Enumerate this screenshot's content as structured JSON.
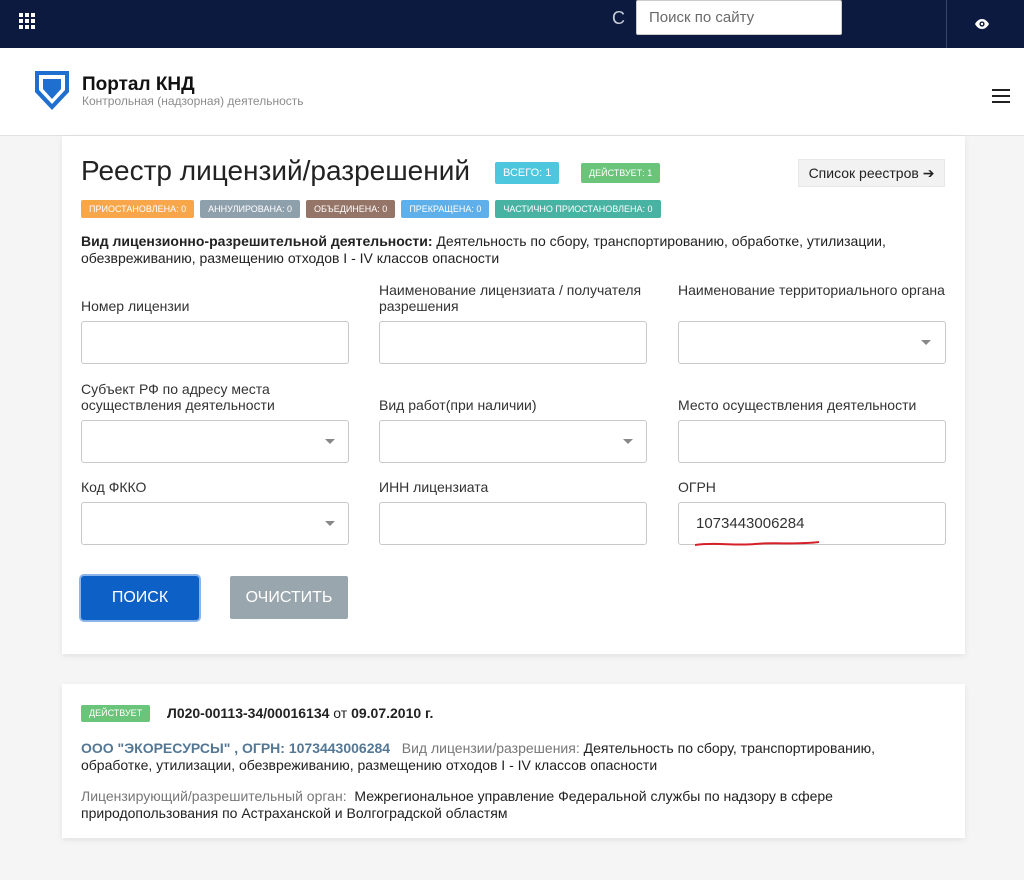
{
  "topbar": {
    "search_placeholder": "Поиск по сайту",
    "search_glyph": "С",
    "apps_icon": "apps-grid-icon",
    "eye_icon": "eye-icon"
  },
  "header": {
    "title": "Портал КНД",
    "subtitle": "Контрольная (надзорная) деятельность"
  },
  "page": {
    "title": "Реестр лицензий/разрешений",
    "badges": {
      "total": "ВСЕГО: 1",
      "active": "ДЕЙСТВУЕТ: 1"
    },
    "registry_list_button": "Список реестров ➔",
    "statuses": [
      "ПРИОСТАНОВЛЕНА: 0",
      "АННУЛИРОВАНА: 0",
      "ОБЪЕДИНЕНА: 0",
      "ПРЕКРАЩЕНА: 0",
      "ЧАСТИЧНО ПРИОСТАНОВЛЕНА: 0"
    ],
    "activity_label": "Вид лицензионно-разрешительной деятельности:",
    "activity_value": " Деятельность по сбору, транспортированию, обработке, утилизации, обезвреживанию, размещению отходов I - IV классов опасности"
  },
  "form": {
    "license_number": {
      "label": "Номер лицензии",
      "value": ""
    },
    "licensee_name": {
      "label": "Наименование лицензиата / получателя разрешения",
      "value": ""
    },
    "territorial_body": {
      "label": "Наименование территориального органа",
      "value": ""
    },
    "subject_rf": {
      "label": "Субъект РФ по адресу места осуществления деятельности",
      "value": ""
    },
    "work_type": {
      "label": "Вид работ(при наличии)",
      "value": ""
    },
    "activity_place": {
      "label": "Место осуществления деятельности",
      "value": ""
    },
    "fkko_code": {
      "label": "Код ФККО",
      "value": ""
    },
    "inn": {
      "label": "ИНН лицензиата",
      "value": ""
    },
    "ogrn": {
      "label": "ОГРН",
      "value": "1073443006284"
    },
    "search_button": "ПОИСК",
    "clear_button": "ОЧИСТИТЬ"
  },
  "result": {
    "status": "ДЕЙСТВУЕТ",
    "number": "Л020-00113-34/00016134",
    "from_word": " от ",
    "date": "09.07.2010 г.",
    "org": "ООО \"ЭКОРЕСУРСЫ\" , ОГРН: 1073443006284",
    "kind_label": "Вид лицензии/разрешения:",
    "kind_value": " Деятельность по сбору, транспортированию, обработке, утилизации, обезвреживанию, размещению отходов I - IV классов опасности",
    "authority_label": "Лицензирующий/разрешительный орган:",
    "authority_value": " Межрегиональное управление Федеральной службы по надзору в сфере природопользования по Астраханской и Волгоградской областям"
  },
  "colors": {
    "topbar": "#0c1a3f",
    "primary": "#0d61c6",
    "active_badge": "#6ac57a",
    "total_badge": "#4dc7de"
  }
}
